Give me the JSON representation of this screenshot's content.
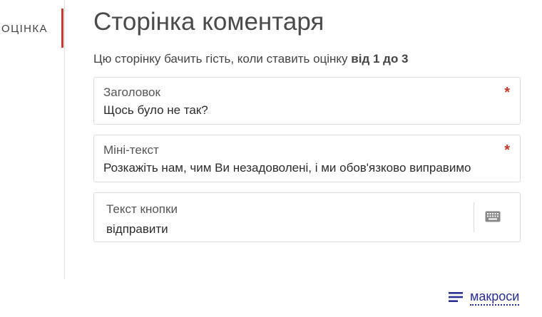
{
  "sidebar": {
    "active_item_label": "ОЦІНКА"
  },
  "main": {
    "title": "Сторінка коментаря",
    "description_prefix": "Цю сторінку бачить гість, коли ставить оцінку ",
    "description_bold": "від 1 до 3"
  },
  "fields": {
    "title": {
      "label": "Заголовок",
      "value": "Щось було не так?",
      "required_mark": "*"
    },
    "mini_text": {
      "label": "Міні-текст",
      "value": "Розкажіть нам, чим Ви незадоволені, і ми обов'язково виправимо",
      "required_mark": "*"
    },
    "button_text": {
      "label": "Текст кнопки",
      "value": "відправити",
      "icon": "keyboard-icon"
    }
  },
  "footer": {
    "macros_label": "макроси",
    "macros_icon": "list-icon"
  },
  "colors": {
    "accent_red": "#c83a32",
    "required_red": "#c0392b",
    "link_blue": "#2b2f8f"
  }
}
